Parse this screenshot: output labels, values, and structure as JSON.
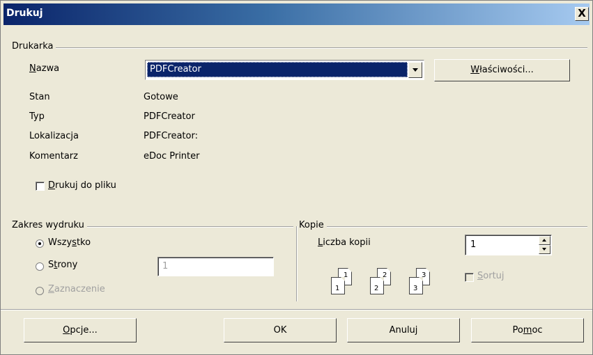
{
  "window": {
    "title": "Drukuj",
    "close_glyph": "X"
  },
  "printer": {
    "group_label": "Drukarka",
    "name_label_key": "N",
    "name_label_rest": "azwa",
    "name_value": "PDFCreator",
    "properties_key": "W",
    "properties_rest": "łaściwości...",
    "rows": [
      {
        "label": "Stan",
        "value": "Gotowe"
      },
      {
        "label": "Typ",
        "value": "PDFCreator"
      },
      {
        "label": "Lokalizacja",
        "value": "PDFCreator:"
      },
      {
        "label": "Komentarz",
        "value": "eDoc Printer"
      }
    ],
    "print_to_file_key": "D",
    "print_to_file_rest": "rukuj do pliku",
    "print_to_file_checked": false
  },
  "range": {
    "group_label": "Zakres wydruku",
    "all_pre": "Wszy",
    "all_key": "s",
    "all_post": "tko",
    "pages_pre": "S",
    "pages_key": "t",
    "pages_post": "rony",
    "pages_value": "1",
    "selection_key": "Z",
    "selection_rest": "aznaczenie",
    "selected": "all"
  },
  "copies": {
    "group_label": "Kopie",
    "count_key": "L",
    "count_rest": "iczba kopii",
    "count_value": "1",
    "collate_key": "S",
    "collate_rest": "ortuj",
    "collate_checked": false,
    "collate_enabled": false,
    "page_icons": [
      {
        "back": "1",
        "front": "1"
      },
      {
        "back": "2",
        "front": "2"
      },
      {
        "back": "3",
        "front": "3"
      }
    ]
  },
  "buttons": {
    "options_key": "O",
    "options_rest": "pcje...",
    "ok": "OK",
    "cancel": "Anuluj",
    "help_pre": "Po",
    "help_key": "m",
    "help_post": "oc"
  },
  "colors": {
    "title_start": "#0a246a",
    "title_end": "#a6caf0",
    "face": "#ece9d8",
    "selection": "#0a246a"
  }
}
